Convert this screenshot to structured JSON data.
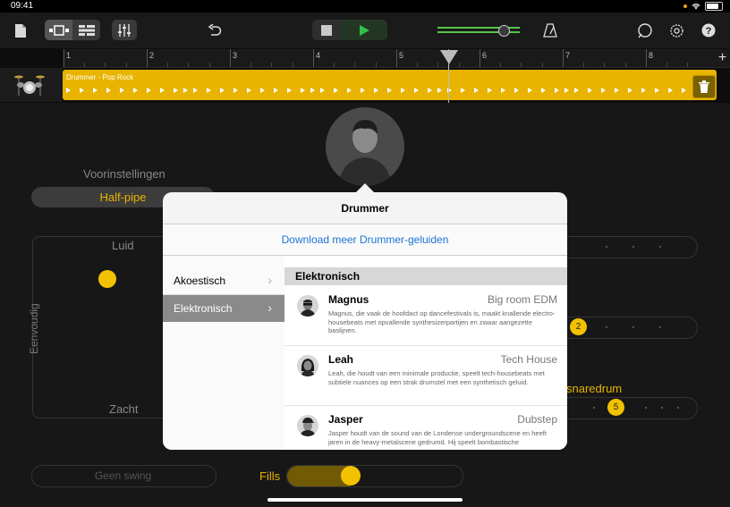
{
  "status": {
    "time": "09:41"
  },
  "ruler": {
    "bars": [
      "1",
      "2",
      "3",
      "4",
      "5",
      "6",
      "7",
      "8"
    ]
  },
  "track": {
    "region_name": "Drummer - Pop Rock"
  },
  "editor": {
    "presets_title": "Voorinstellingen",
    "preset_value": "Half-pipe",
    "pad": {
      "top": "Luid",
      "bottom": "Zacht",
      "left": "Eenvoudig"
    },
    "slider1_value": "2",
    "slider2_label": "snaredrum",
    "slider2_value": "5",
    "swing_label": "Geen swing",
    "fills_label": "Fills"
  },
  "popover": {
    "title": "Drummer",
    "download_link": "Download meer Drummer-geluiden",
    "categories": [
      {
        "label": "Akoestisch",
        "selected": false
      },
      {
        "label": "Elektronisch",
        "selected": true
      }
    ],
    "section_header": "Elektronisch",
    "drummers": [
      {
        "name": "Magnus",
        "genre": "Big room EDM",
        "description": "Magnus, die vaak de hoofdact op dancefestivals is, maakt knallende electro-housebeats met opvallende synthesizerpartijen en zwaar aangezette baslijnen."
      },
      {
        "name": "Leah",
        "genre": "Tech House",
        "description": "Leah, die houdt van een minimale productie, speelt tech-housebeats met subtiele nuances op een strak drumstel met een synthetisch geluid."
      },
      {
        "name": "Jasper",
        "genre": "Dubstep",
        "description": "Jasper houdt van de sound van de Londense undergroundscene en heeft jaren in de heavy-metalscene gedrumd. Hij speelt bombastische"
      }
    ]
  },
  "colors": {
    "accent": "#f2c100",
    "region": "#e8b400",
    "link": "#1a73d6"
  }
}
